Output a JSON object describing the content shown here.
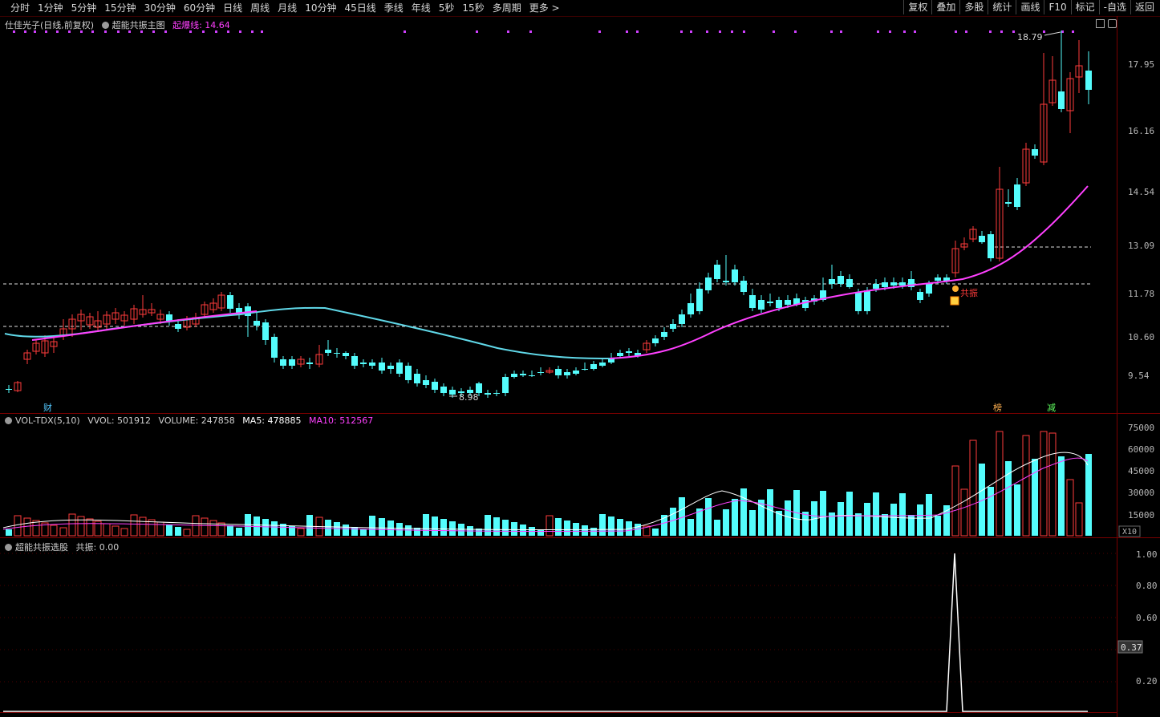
{
  "toolbar": {
    "periods": [
      "分时",
      "1分钟",
      "5分钟",
      "15分钟",
      "30分钟",
      "60分钟",
      "日线",
      "周线",
      "月线",
      "10分钟",
      "45日线",
      "季线",
      "年线",
      "5秒",
      "15秒",
      "多周期",
      "更多 >"
    ],
    "right": [
      "复权",
      "叠加",
      "多股",
      "统计",
      "画线",
      "F10",
      "标记",
      "-自选",
      "返回"
    ]
  },
  "main": {
    "stock_title": "仕佳光子(日线,前复权)",
    "indicator_name": "超能共振主图",
    "indicator_line": "起爆线: 14.64",
    "price_axis": [
      "17.95",
      "16.16",
      "14.54",
      "13.09",
      "11.78",
      "10.60",
      "9.54"
    ],
    "high_label": "18.79",
    "low_label": "8.98",
    "marker_cai": "财",
    "marker_bang": "榜",
    "marker_jian": "减",
    "resonance_label": "共振",
    "colors": {
      "up": "#ff3c3c",
      "down": "#54fcfc",
      "ma": "#ff40ff",
      "ma_cool": "#60d8e8"
    }
  },
  "volume": {
    "title": "VOL-TDX(5,10)",
    "vvol": "VVOL: 501912",
    "volume": "VOLUME: 247858",
    "ma5": "MA5: 478885",
    "ma10": "MA10: 512567",
    "axis": [
      "75000",
      "60000",
      "45000",
      "30000",
      "15000"
    ],
    "unit": "X10"
  },
  "sub": {
    "title": "超能共振选股",
    "value": "共振: 0.00",
    "axis": [
      "1.00",
      "0.80",
      "0.60",
      "0.20"
    ],
    "current_value": "0.37"
  }
}
